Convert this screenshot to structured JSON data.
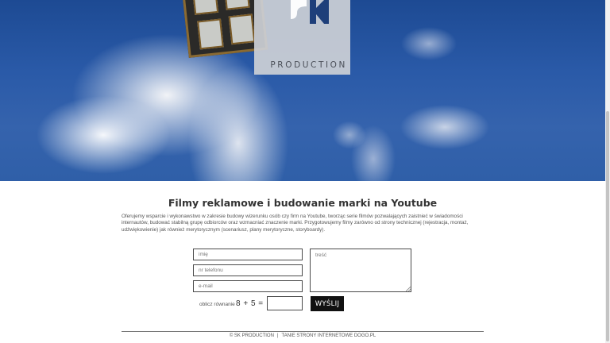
{
  "hero": {
    "logo_text": "PRODUCTION"
  },
  "section": {
    "title": "Filmy reklamowe i budowanie marki na Youtube",
    "intro": "Oferujemy wsparcie i wykonawstwo w zakresie budowy wizerunku osób czy firm na Youtube, tworząc serie filmów pozwalających zaistnieć w świadomości internautów, budować stabilną grupę odbiorców oraz wzmacniać znaczenie marki. Przygotowujemy filmy zarówno od strony technicznej (rejestracja, montaż, udźwiękowienie) jak również merytorycznym (scenariusz, plany merytoryczne, storyboardy)."
  },
  "form": {
    "name_placeholder": "imię",
    "phone_placeholder": "nr telefonu",
    "email_placeholder": "e-mail",
    "message_placeholder": "treść",
    "captcha_label": "oblicz równanie",
    "captcha_equation": "8 + 5 =",
    "captcha_value": "",
    "send_label": "WYŚLIJ"
  },
  "footer": {
    "copyright": "© SK PRODUCTION",
    "separator": "|",
    "link_prefix": "TANIE STRONY INTERNETOWE",
    "link_brand": "DOGO.PL"
  },
  "colors": {
    "sky": "#2a5aa8",
    "button": "#111111",
    "logo_panel": "#cdd0d6"
  }
}
